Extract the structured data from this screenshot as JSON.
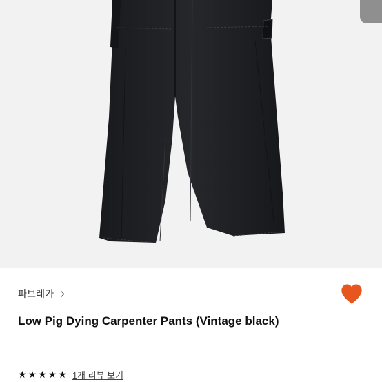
{
  "product": {
    "brand": "파브레가",
    "title": "Low Pig Dying Carpenter Pants (Vintage black)",
    "liked": true,
    "rating_stars": 5,
    "review_link": "1개 리뷰 보기"
  },
  "icons": {
    "brand_chevron": "chevron-right-icon",
    "like": "heart-icon",
    "star": "star-icon"
  },
  "colors": {
    "like_heart": "#e8561f",
    "image_background": "#f2f2f2",
    "pants": "#1e1f22"
  }
}
